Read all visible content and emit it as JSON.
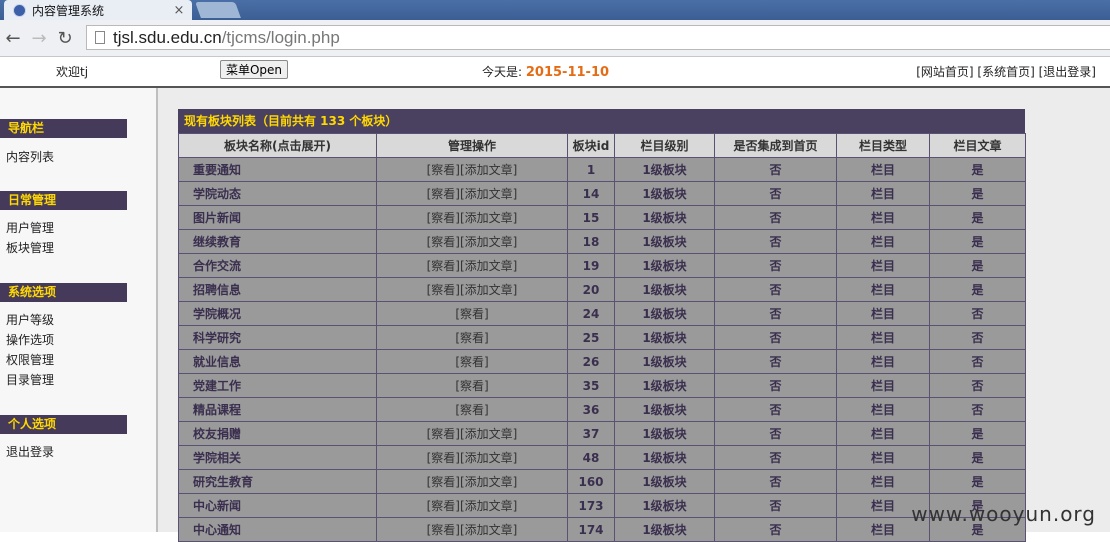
{
  "browser": {
    "tab_title": "内容管理系统",
    "close_glyph": "×",
    "url_host": "tjsl.sdu.edu.cn",
    "url_path": "/tjcms/login.php"
  },
  "topbar": {
    "welcome": "欢迎tj",
    "menu_button": "菜单Open",
    "today_label": "今天是:",
    "today_date": "2015-11-10",
    "links": [
      "[网站首页]",
      "[系统首页]",
      "[退出登录]"
    ]
  },
  "sidebar": {
    "sections": [
      {
        "title": "导航栏",
        "items": [
          "内容列表"
        ]
      },
      {
        "title": "日常管理",
        "items": [
          "用户管理",
          "板块管理"
        ]
      },
      {
        "title": "系统选项",
        "items": [
          "用户等级",
          "操作选项",
          "权限管理",
          "目录管理"
        ]
      },
      {
        "title": "个人选项",
        "items": [
          "退出登录"
        ]
      }
    ]
  },
  "table": {
    "caption": "现有板块列表（目前共有 133 个板块）",
    "headers": [
      "板块名称(点击展开)",
      "管理操作",
      "板块id",
      "栏目级别",
      "是否集成到首页",
      "栏目类型",
      "栏目文章"
    ],
    "rows": [
      [
        "重要通知",
        "[察看][添加文章]",
        "1",
        "1级板块",
        "否",
        "栏目",
        "是"
      ],
      [
        "学院动态",
        "[察看][添加文章]",
        "14",
        "1级板块",
        "否",
        "栏目",
        "是"
      ],
      [
        "图片新闻",
        "[察看][添加文章]",
        "15",
        "1级板块",
        "否",
        "栏目",
        "是"
      ],
      [
        "继续教育",
        "[察看][添加文章]",
        "18",
        "1级板块",
        "否",
        "栏目",
        "是"
      ],
      [
        "合作交流",
        "[察看][添加文章]",
        "19",
        "1级板块",
        "否",
        "栏目",
        "是"
      ],
      [
        "招聘信息",
        "[察看][添加文章]",
        "20",
        "1级板块",
        "否",
        "栏目",
        "是"
      ],
      [
        "学院概况",
        "[察看]",
        "24",
        "1级板块",
        "否",
        "栏目",
        "否"
      ],
      [
        "科学研究",
        "[察看]",
        "25",
        "1级板块",
        "否",
        "栏目",
        "否"
      ],
      [
        "就业信息",
        "[察看]",
        "26",
        "1级板块",
        "否",
        "栏目",
        "否"
      ],
      [
        "党建工作",
        "[察看]",
        "35",
        "1级板块",
        "否",
        "栏目",
        "否"
      ],
      [
        "精品课程",
        "[察看]",
        "36",
        "1级板块",
        "否",
        "栏目",
        "否"
      ],
      [
        "校友捐赠",
        "[察看][添加文章]",
        "37",
        "1级板块",
        "否",
        "栏目",
        "是"
      ],
      [
        "学院相关",
        "[察看][添加文章]",
        "48",
        "1级板块",
        "否",
        "栏目",
        "是"
      ],
      [
        "研究生教育",
        "[察看][添加文章]",
        "160",
        "1级板块",
        "否",
        "栏目",
        "是"
      ],
      [
        "中心新闻",
        "[察看][添加文章]",
        "173",
        "1级板块",
        "否",
        "栏目",
        "是"
      ],
      [
        "中心通知",
        "[察看][添加文章]",
        "174",
        "1级板块",
        "否",
        "栏目",
        "是"
      ]
    ]
  },
  "watermark": "www.wooyun.org"
}
